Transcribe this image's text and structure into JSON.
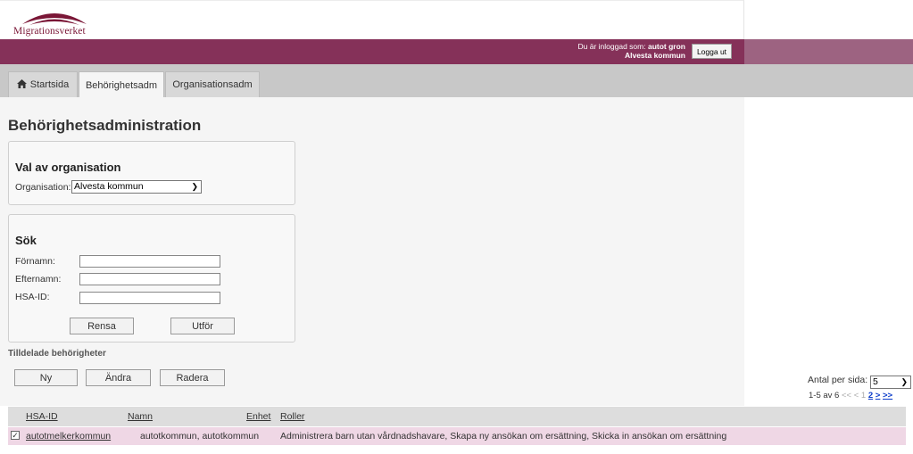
{
  "app": {
    "brand": "Migrationsverket"
  },
  "session": {
    "prefix": "Du är inloggad som:",
    "user": "autot gron",
    "org": "Alvesta kommun",
    "logout_label": "Logga ut"
  },
  "tabs": [
    {
      "label": "Startsida",
      "icon": "home-icon"
    },
    {
      "label": "Behörighetsadm",
      "active": true
    },
    {
      "label": "Organisationsadm"
    }
  ],
  "page": {
    "title": "Behörighetsadministration"
  },
  "org_panel": {
    "heading": "Val av organisation",
    "label": "Organisation:",
    "selected": "Alvesta kommun"
  },
  "search_panel": {
    "heading": "Sök",
    "first_name_label": "Förnamn:",
    "last_name_label": "Efternamn:",
    "hsa_label": "HSA-ID:",
    "clear_label": "Rensa",
    "run_label": "Utför"
  },
  "permissions": {
    "section_label": "Tilldelade behörigheter",
    "new_label": "Ny",
    "edit_label": "Ändra",
    "delete_label": "Radera",
    "per_page_label": "Antal per sida:",
    "per_page_value": "5",
    "pager_range": "1-5 av 6",
    "pager_first": "<<",
    "pager_prev": "<",
    "pager_page1": "1",
    "pager_page2": "2",
    "pager_next": ">",
    "pager_last": ">>"
  },
  "table": {
    "columns": [
      "HSA-ID",
      "Namn",
      "Enhet",
      "Roller"
    ],
    "rows": [
      {
        "hsa": "autotmelkerkommun",
        "name": "autotkommun, autotkommun",
        "unit": "",
        "roles": "Administrera barn utan vårdnadshavare, Skapa ny ansökan om ersättning, Skicka in ansökan om ersättning",
        "checked": true
      }
    ]
  },
  "colors": {
    "brand_purple": "#853159",
    "row_highlight": "#efd7e5"
  }
}
